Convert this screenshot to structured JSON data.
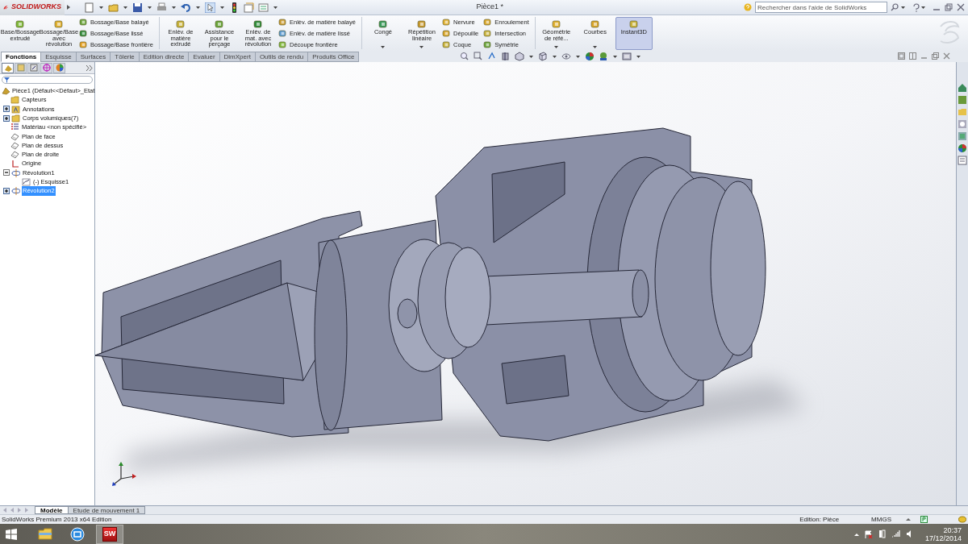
{
  "app": {
    "logo": "SOLIDWORKS",
    "title": "Pièce1 *"
  },
  "search": {
    "placeholder": "Rechercher dans l'aide de SolidWorks"
  },
  "ribbon": {
    "groups": [
      [
        {
          "kind": "large",
          "label": "Base/Bossage extrudé",
          "dropdown": false,
          "selected": false
        },
        {
          "kind": "large",
          "label": "Bossage/Base avec révolution",
          "dropdown": false,
          "selected": false
        },
        {
          "kind": "stack",
          "items": [
            "Bossage/Base balayé",
            "Bossage/Base lissé",
            "Bossage/Base frontière"
          ]
        }
      ],
      [
        {
          "kind": "large",
          "label": "Enlèv. de matière extrudé",
          "dropdown": false,
          "selected": false
        },
        {
          "kind": "large",
          "label": "Assistance pour le perçage",
          "dropdown": false,
          "selected": false
        },
        {
          "kind": "large",
          "label": "Enlèv. de mat. avec révolution",
          "dropdown": false,
          "selected": false
        },
        {
          "kind": "stack",
          "items": [
            "Enlèv. de matière balayé",
            "Enlèv. de matière lissé",
            "Découpe frontière"
          ]
        }
      ],
      [
        {
          "kind": "large",
          "label": "Congé",
          "dropdown": true,
          "selected": false
        },
        {
          "kind": "large",
          "label": "Répétition linéaire",
          "dropdown": true,
          "selected": false
        },
        {
          "kind": "stack",
          "items": [
            "Nervure",
            "Dépouille",
            "Coque"
          ]
        },
        {
          "kind": "stack",
          "items": [
            "Enroulement",
            "Intersection",
            "Symétrie"
          ]
        }
      ],
      [
        {
          "kind": "large",
          "label": "Géométrie de réfé...",
          "dropdown": true,
          "selected": false
        },
        {
          "kind": "large",
          "label": "Courbes",
          "dropdown": true,
          "selected": false
        },
        {
          "kind": "large",
          "label": "Instant3D",
          "dropdown": false,
          "selected": true
        }
      ]
    ]
  },
  "tabs": [
    {
      "label": "Fonctions",
      "selected": true
    },
    {
      "label": "Esquisse",
      "selected": false
    },
    {
      "label": "Surfaces",
      "selected": false
    },
    {
      "label": "Tôlerie",
      "selected": false
    },
    {
      "label": "Edition directe",
      "selected": false
    },
    {
      "label": "Evaluer",
      "selected": false
    },
    {
      "label": "DimXpert",
      "selected": false
    },
    {
      "label": "Outils de rendu",
      "selected": false
    },
    {
      "label": "Produits Office",
      "selected": false
    }
  ],
  "panel_tabs": [
    {
      "selected": true
    },
    {
      "selected": false
    },
    {
      "selected": false
    },
    {
      "selected": false
    },
    {
      "selected": false
    }
  ],
  "tree": {
    "label": "Pièce1  (Défaut<<Défaut>_Etat",
    "children": [
      {
        "label": "Capteurs",
        "kind": "folder",
        "selected": false
      },
      {
        "label": "Annotations",
        "kind": "annotation",
        "expanded": false,
        "selected": false
      },
      {
        "label": "Corps volumiques(7)",
        "kind": "folder",
        "expanded": false,
        "selected": false
      },
      {
        "label": "Matériau <non spécifié>",
        "kind": "material",
        "selected": false
      },
      {
        "label": "Plan de face",
        "kind": "plane",
        "selected": false
      },
      {
        "label": "Plan de dessus",
        "kind": "plane",
        "selected": false
      },
      {
        "label": "Plan de droite",
        "kind": "plane",
        "selected": false
      },
      {
        "label": "Origine",
        "kind": "origin",
        "selected": false
      },
      {
        "label": "Révolution1",
        "kind": "revolve",
        "expanded": true,
        "selected": false,
        "children": [
          {
            "label": "(-) Esquisse1",
            "kind": "sketch",
            "selected": false
          }
        ]
      },
      {
        "label": "Révolution2",
        "kind": "revolve",
        "expanded": false,
        "selected": true
      }
    ]
  },
  "bottom_tabs": [
    {
      "label": "Modèle",
      "selected": true
    },
    {
      "label": "Etude de mouvement 1",
      "selected": false
    }
  ],
  "status_bar": {
    "product": "SolidWorks Premium 2013 x64 Edition",
    "mode": "Edition: Pièce",
    "units": "MMGS"
  },
  "taskbar": {
    "apps": [
      {
        "kind": "explorer"
      },
      {
        "kind": "maxthon"
      },
      {
        "kind": "solidworks",
        "label": "SW"
      }
    ],
    "time": "20:37",
    "date": "17/12/2014"
  }
}
